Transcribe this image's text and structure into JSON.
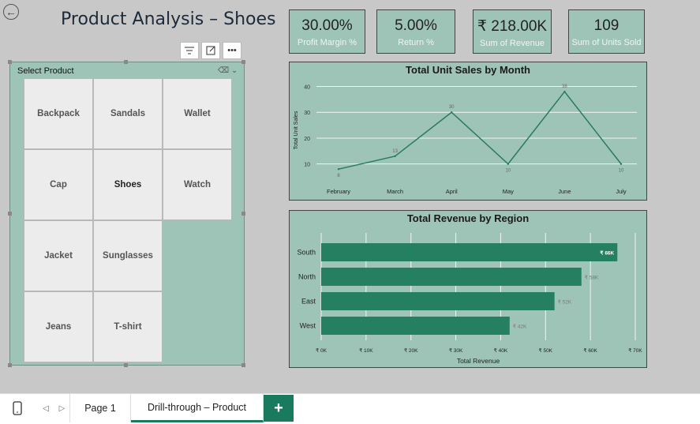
{
  "page": {
    "title": "Product Analysis – Shoes"
  },
  "kpis": [
    {
      "value": "30.00%",
      "label": "Profit Margin %"
    },
    {
      "value": "5.00%",
      "label": "Return %"
    },
    {
      "value": "₹ 218.00K",
      "label": "Sum of Revenue"
    },
    {
      "value": "109",
      "label": "Sum of Units Sold"
    }
  ],
  "visual_header": {
    "filter_icon": "filter-icon",
    "focus_icon": "focus-mode-icon",
    "more_icon": "more-options-icon"
  },
  "slicer": {
    "title": "Select Product",
    "selected": "Shoes",
    "items": [
      "Backpack",
      "Sandals",
      "Wallet",
      "Cap",
      "Shoes",
      "Watch",
      "Jacket",
      "Sunglasses",
      "Jeans",
      "T-shirt"
    ]
  },
  "tabs": {
    "page1": "Page 1",
    "drill": "Drill-through – Product",
    "add": "+"
  },
  "chart_data": [
    {
      "type": "line",
      "title": "Total Unit Sales by Month",
      "ylabel": "Total Unit Sales",
      "xlabel": "",
      "categories": [
        "February",
        "March",
        "April",
        "May",
        "June",
        "July"
      ],
      "values": [
        8,
        13,
        30,
        10,
        38,
        10
      ],
      "yticks": [
        10,
        20,
        30,
        40
      ],
      "ylim": [
        5,
        42
      ],
      "color": "#2a7a63",
      "grid": true
    },
    {
      "type": "bar",
      "orientation": "horizontal",
      "title": "Total Revenue by Region",
      "xlabel": "Total Revenue",
      "ylabel": "",
      "categories": [
        "South",
        "North",
        "East",
        "West"
      ],
      "values": [
        66000,
        58000,
        52000,
        42000
      ],
      "data_labels": [
        "₹ 66K",
        "₹ 58K",
        "₹ 52K",
        "₹ 42K"
      ],
      "xticks": [
        "₹ 0K",
        "₹ 10K",
        "₹ 20K",
        "₹ 30K",
        "₹ 40K",
        "₹ 50K",
        "₹ 60K",
        "₹ 70K"
      ],
      "xlim": [
        0,
        70000
      ],
      "color": "#258061",
      "grid": true
    }
  ]
}
